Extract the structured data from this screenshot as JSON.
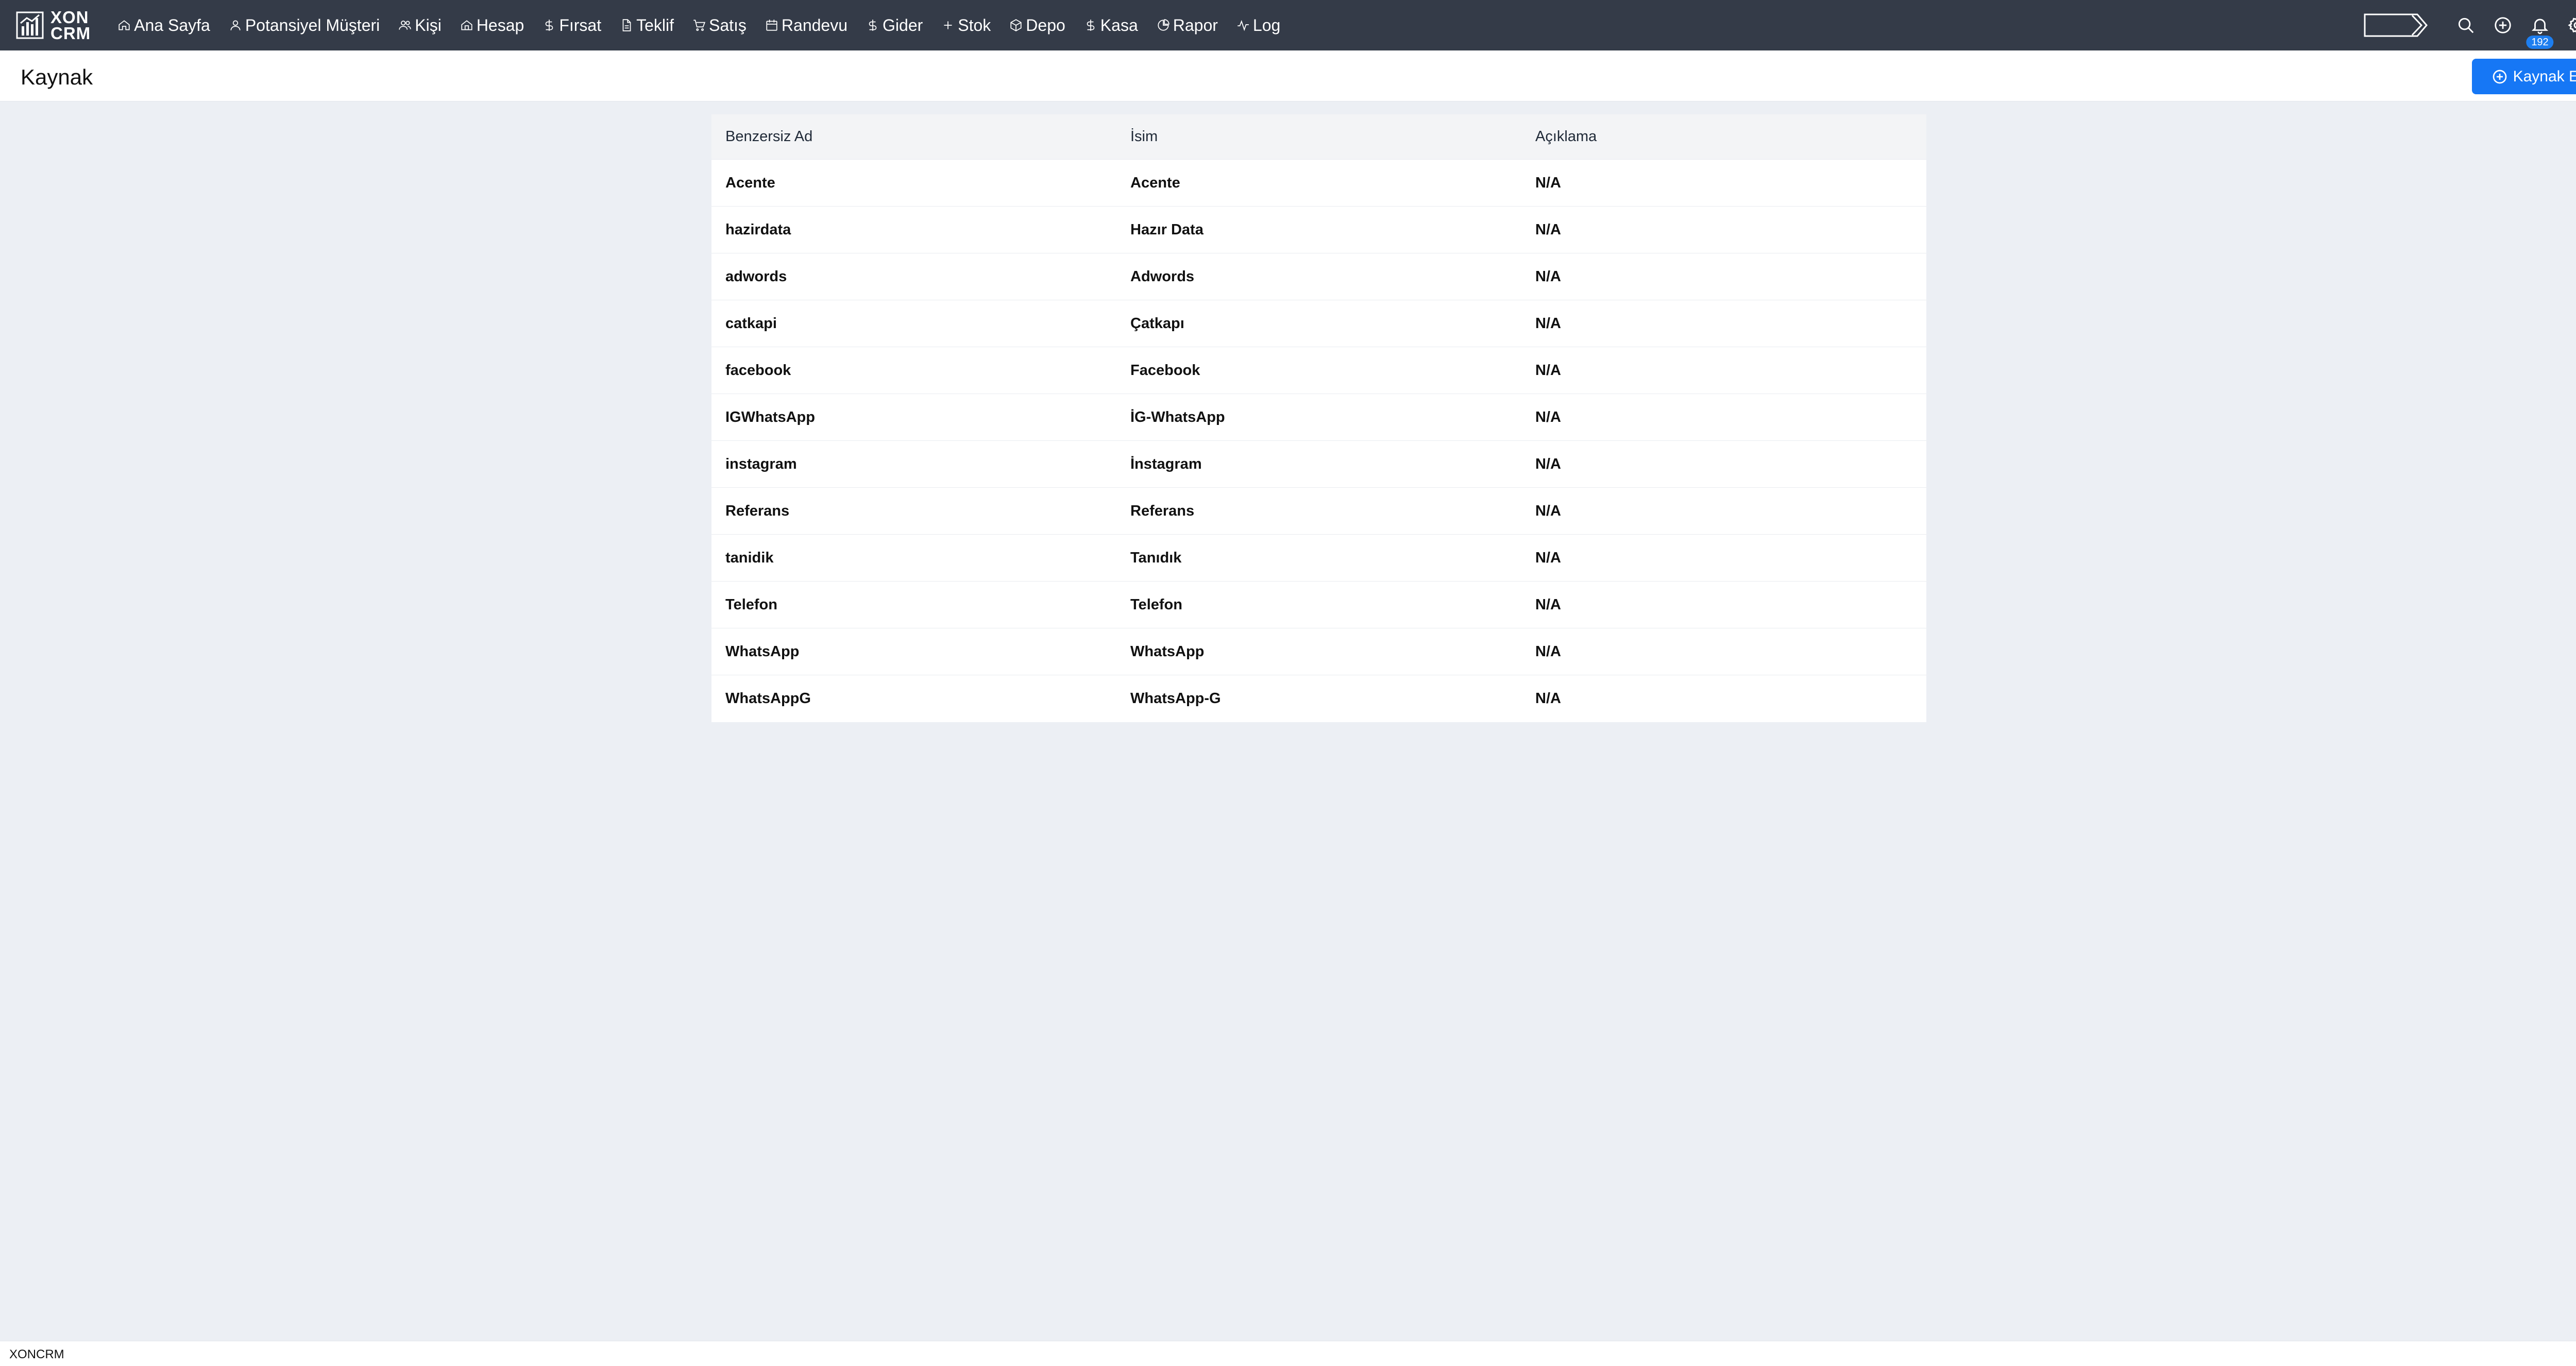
{
  "app": {
    "logo_text_line1": "XON",
    "logo_text_line2": "CRM"
  },
  "nav": {
    "items": [
      {
        "label": "Ana Sayfa",
        "icon": "home-icon"
      },
      {
        "label": "Potansiyel Müşteri",
        "icon": "user-icon"
      },
      {
        "label": "Kişi",
        "icon": "users-icon"
      },
      {
        "label": "Hesap",
        "icon": "building-icon"
      },
      {
        "label": "Fırsat",
        "icon": "dollar-icon"
      },
      {
        "label": "Teklif",
        "icon": "document-icon"
      },
      {
        "label": "Satış",
        "icon": "cart-icon"
      },
      {
        "label": "Randevu",
        "icon": "calendar-icon"
      },
      {
        "label": "Gider",
        "icon": "dollar-icon"
      },
      {
        "label": "Stok",
        "icon": "plus-icon"
      },
      {
        "label": "Depo",
        "icon": "box-icon"
      },
      {
        "label": "Kasa",
        "icon": "dollar-icon"
      },
      {
        "label": "Rapor",
        "icon": "chart-pie-icon"
      },
      {
        "label": "Log",
        "icon": "activity-icon"
      }
    ]
  },
  "notifications": {
    "count": "192"
  },
  "page": {
    "title": "Kaynak",
    "add_button_label": "Kaynak Ekle"
  },
  "table": {
    "headers": [
      "Benzersiz Ad",
      "İsim",
      "Açıklama"
    ],
    "rows": [
      [
        "Acente",
        "Acente",
        "N/A"
      ],
      [
        "hazirdata",
        "Hazır Data",
        "N/A"
      ],
      [
        "adwords",
        "Adwords",
        "N/A"
      ],
      [
        "catkapi",
        "Çatkapı",
        "N/A"
      ],
      [
        "facebook",
        "Facebook",
        "N/A"
      ],
      [
        "IGWhatsApp",
        "İG-WhatsApp",
        "N/A"
      ],
      [
        "instagram",
        "İnstagram",
        "N/A"
      ],
      [
        "Referans",
        "Referans",
        "N/A"
      ],
      [
        "tanidik",
        "Tanıdık",
        "N/A"
      ],
      [
        "Telefon",
        "Telefon",
        "N/A"
      ],
      [
        "WhatsApp",
        "WhatsApp",
        "N/A"
      ],
      [
        "WhatsAppG",
        "WhatsApp-G",
        "N/A"
      ]
    ]
  },
  "footer": {
    "text": "XONCRM"
  },
  "colors": {
    "topbar": "#343b48",
    "accent": "#1677f5",
    "background": "#eceff4"
  }
}
